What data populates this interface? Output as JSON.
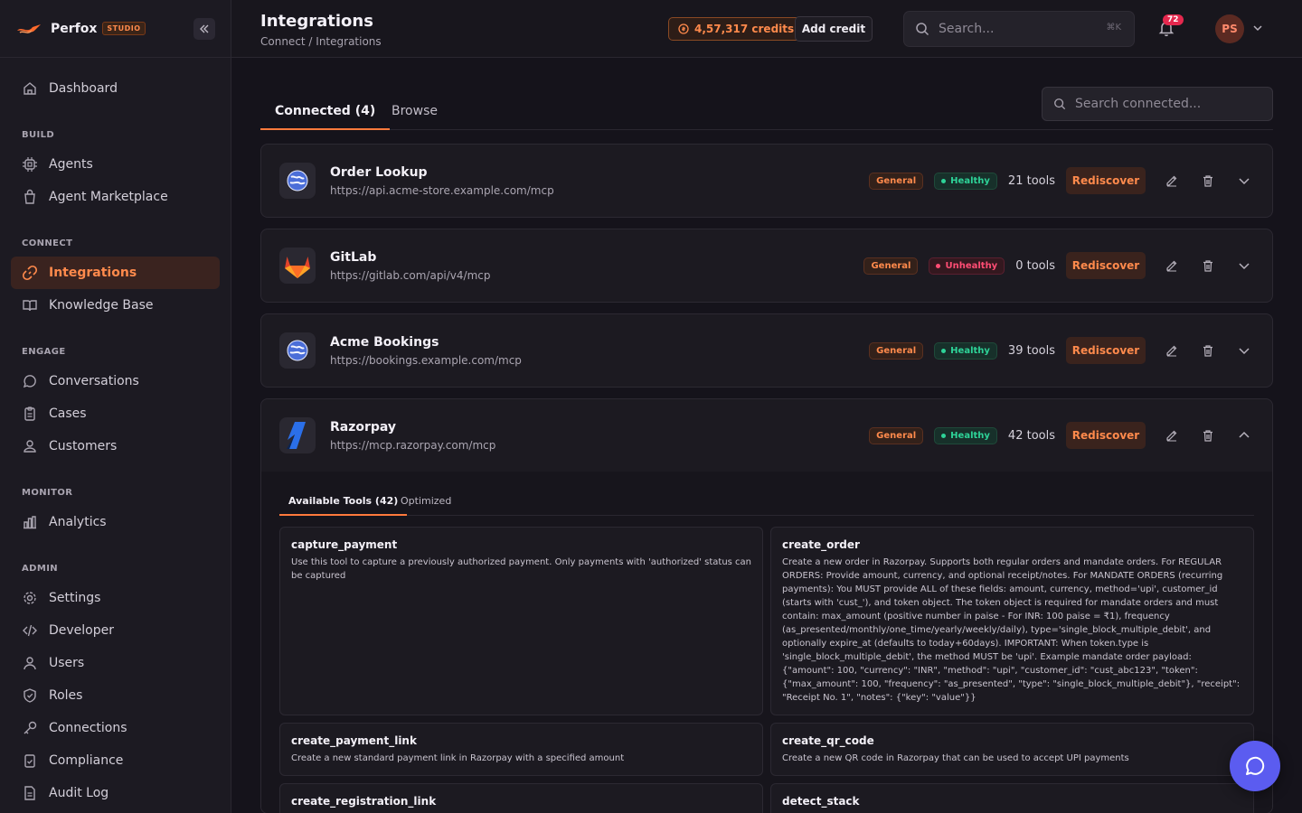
{
  "brand": {
    "name": "Perfox",
    "badge": "STUDIO"
  },
  "sidebar": {
    "dashboard": "Dashboard",
    "sections": {
      "build": "BUILD",
      "connect": "CONNECT",
      "engage": "ENGAGE",
      "monitor": "MONITOR",
      "admin": "ADMIN"
    },
    "items": {
      "agents": "Agents",
      "marketplace": "Agent Marketplace",
      "integrations": "Integrations",
      "knowledge": "Knowledge Base",
      "conversations": "Conversations",
      "cases": "Cases",
      "customers": "Customers",
      "analytics": "Analytics",
      "settings": "Settings",
      "developer": "Developer",
      "users": "Users",
      "roles": "Roles",
      "connections": "Connections",
      "compliance": "Compliance",
      "audit": "Audit Log"
    }
  },
  "header": {
    "title": "Integrations",
    "breadcrumb": "Connect / Integrations",
    "credits": "4,57,317 credits",
    "add_credit": "Add credit",
    "search_placeholder": "Search...",
    "search_shortcut": "⌘K",
    "notifications": "72",
    "avatar_initials": "PS"
  },
  "tabs": {
    "connected": "Connected (4)",
    "browse": "Browse"
  },
  "search_connected_placeholder": "Search connected...",
  "integrations": [
    {
      "name": "Order Lookup",
      "url": "https://api.acme-store.example.com/mcp",
      "category": "General",
      "health": "Healthy",
      "tools": "21 tools"
    },
    {
      "name": "GitLab",
      "url": "https://gitlab.com/api/v4/mcp",
      "category": "General",
      "health": "Unhealthy",
      "tools": "0 tools"
    },
    {
      "name": "Acme Bookings",
      "url": "https://bookings.example.com/mcp",
      "category": "General",
      "health": "Healthy",
      "tools": "39 tools"
    },
    {
      "name": "Razorpay",
      "url": "https://mcp.razorpay.com/mcp",
      "category": "General",
      "health": "Healthy",
      "tools": "42 tools"
    }
  ],
  "rediscover_label": "Rediscover",
  "expanded": {
    "subtabs": {
      "available": "Available Tools (42)",
      "optimized": "Optimized"
    },
    "tools": [
      {
        "name": "capture_payment",
        "desc": "Use this tool to capture a previously authorized payment. Only payments with 'authorized' status can be captured"
      },
      {
        "name": "create_order",
        "desc": "Create a new order in Razorpay. Supports both regular orders and mandate orders. For REGULAR ORDERS: Provide amount, currency, and optional receipt/notes. For MANDATE ORDERS (recurring payments): You MUST provide ALL of these fields: amount, currency, method='upi', customer_id (starts with 'cust_'), and token object. The token object is required for mandate orders and must contain: max_amount (positive number in paise - For INR: 100 paise = ₹1), frequency (as_presented/monthly/one_time/yearly/weekly/daily), type='single_block_multiple_debit', and optionally expire_at (defaults to today+60days). IMPORTANT: When token.type is 'single_block_multiple_debit', the method MUST be 'upi'. Example mandate order payload: {\"amount\": 100, \"currency\": \"INR\", \"method\": \"upi\", \"customer_id\": \"cust_abc123\", \"token\": {\"max_amount\": 100, \"frequency\": \"as_presented\", \"type\": \"single_block_multiple_debit\"}, \"receipt\": \"Receipt No. 1\", \"notes\": {\"key\": \"value\"}}"
      },
      {
        "name": "create_payment_link",
        "desc": "Create a new standard payment link in Razorpay with a specified amount"
      },
      {
        "name": "create_qr_code",
        "desc": "Create a new QR code in Razorpay that can be used to accept UPI payments"
      },
      {
        "name": "create_registration_link",
        "desc": ""
      },
      {
        "name": "detect_stack",
        "desc": ""
      }
    ]
  },
  "colors": {
    "accent": "#ff7a3c",
    "healthy": "#2ed398",
    "unhealthy": "#ff4d74",
    "fab": "#5b5cf0"
  }
}
